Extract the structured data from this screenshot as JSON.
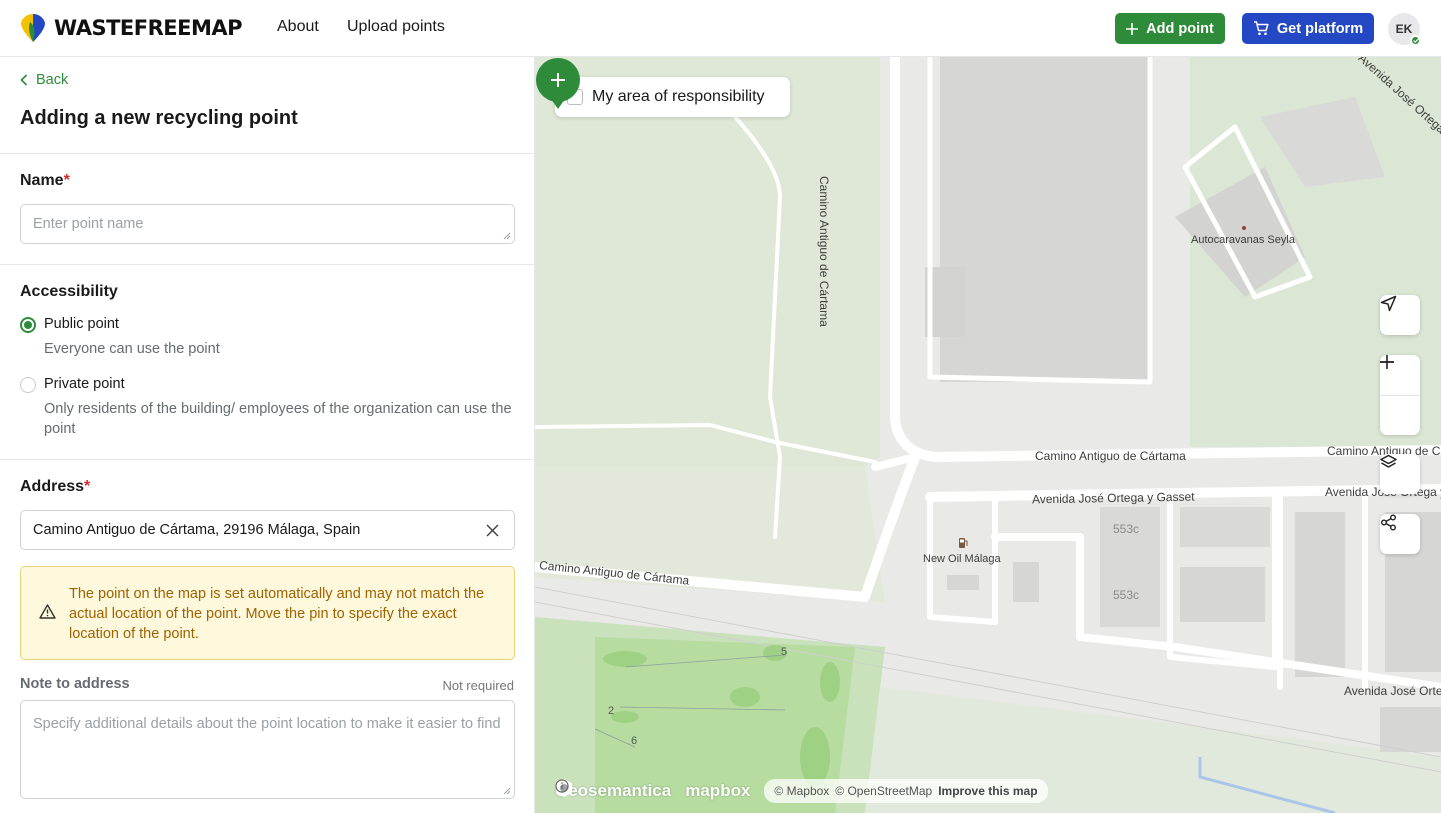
{
  "header": {
    "logo_text": "WASTEFREEMAP",
    "nav": [
      "About",
      "Upload points"
    ],
    "add_point_label": "Add point",
    "get_platform_label": "Get platform",
    "avatar_initials": "EK",
    "colors": {
      "green": "#2e8b3a",
      "blue": "#2448c4"
    }
  },
  "form": {
    "back_label": "Back",
    "title": "Adding a new recycling point",
    "name": {
      "label": "Name",
      "required_mark": "*",
      "placeholder": "Enter point name",
      "value": ""
    },
    "accessibility": {
      "label": "Accessibility",
      "options": [
        {
          "title": "Public point",
          "description": "Everyone can use the point",
          "selected": true
        },
        {
          "title": "Private point",
          "description": "Only residents of the building/ employees of the organization can use the point",
          "selected": false
        }
      ]
    },
    "address": {
      "label": "Address",
      "required_mark": "*",
      "value": "Camino Antiguo de Cártama, 29196 Málaga, Spain"
    },
    "warning": "The point on the map is set automatically and may not match the actual location of the point. Move the pin to specify the exact location of the point.",
    "note": {
      "label": "Note to address",
      "hint": "Not required",
      "placeholder": "Specify additional details about the point location to make it easier to find"
    }
  },
  "map": {
    "area_checkbox_label": "My area of responsibility",
    "labels": {
      "road_vertical": "Camino Antiguo de Cártama",
      "road_main": "Camino Antiguo de Cártama",
      "road_main_right": "Camino Antiguo de Cártama",
      "road_lower": "Camino Antiguo de Cártama",
      "avenue": "Avenida José Ortega y Gasset",
      "avenue_right": "Avenida José Ortega y Gasset",
      "avenue_bottom": "Avenida José Ortega y Gasset",
      "avenue_top_right": "Avenida José Ortega y Gasset",
      "autocaravanas": "Autocaravanas Seyla",
      "new_oil": "New Oil Málaga",
      "building_1": "553c",
      "building_2": "553c",
      "golf_5": "5",
      "golf_2": "2",
      "golf_6": "6"
    },
    "attribution": {
      "geosemantica": "Geosemantica",
      "mapbox": "mapbox",
      "mapbox_copy": "© Mapbox",
      "osm_copy": "© OpenStreetMap",
      "improve": "Improve this map"
    }
  }
}
